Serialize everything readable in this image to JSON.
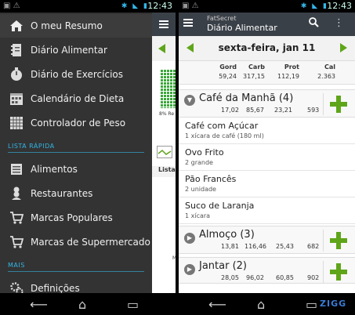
{
  "left_screen": {
    "time": "12:43",
    "drawer": {
      "items": [
        {
          "label": "O meu Resumo",
          "icon": "home-icon"
        },
        {
          "label": "Diário Alimentar",
          "icon": "notebook-icon"
        },
        {
          "label": "Diário de Exercícios",
          "icon": "stopwatch-icon"
        },
        {
          "label": "Calendário de Dieta",
          "icon": "calendar-icon"
        },
        {
          "label": "Controlador de Peso",
          "icon": "weight-grid-icon"
        }
      ],
      "section_quick": "LISTA RÁPIDA",
      "quick_items": [
        {
          "label": "Alimentos",
          "icon": "food-list-icon"
        },
        {
          "label": "Restaurantes",
          "icon": "chef-icon"
        },
        {
          "label": "Marcas Populares",
          "icon": "cart-icon"
        },
        {
          "label": "Marcas de Supermercado",
          "icon": "cart-icon"
        }
      ],
      "section_more": "MAIS",
      "more_items": [
        {
          "label": "Definições",
          "icon": "gears-icon"
        }
      ]
    },
    "behind": {
      "percent_text": "8% Re",
      "list_label": "Lista",
      "m_label": "M"
    }
  },
  "right_screen": {
    "time": "12:43",
    "app_name": "FatSecret",
    "screen_title": "Diário Alimentar",
    "date": "sexta-feira, jan 11",
    "summary": {
      "headers": [
        "Gord",
        "Carb",
        "Prot",
        "Cal"
      ],
      "values": [
        "59,24",
        "317,15",
        "112,19",
        "2.363"
      ]
    },
    "meals": [
      {
        "name": "Café da Manhã (4)",
        "values": [
          "17,02",
          "85,67",
          "23,21",
          "593"
        ],
        "foods": [
          {
            "name": "Café com Açúcar",
            "portion": "1 xícara de café (180 ml)"
          },
          {
            "name": "Ovo Frito",
            "portion": "2 grande"
          },
          {
            "name": "Pão Francês",
            "portion": "2 unidade"
          },
          {
            "name": "Suco de Laranja",
            "portion": "1 xícara"
          }
        ]
      },
      {
        "name": "Almoço (3)",
        "values": [
          "13,81",
          "116,46",
          "25,43",
          "682"
        ]
      },
      {
        "name": "Jantar (2)",
        "values": [
          "28,05",
          "96,02",
          "60,85",
          "902"
        ]
      }
    ],
    "watermark": "ZIGG"
  }
}
